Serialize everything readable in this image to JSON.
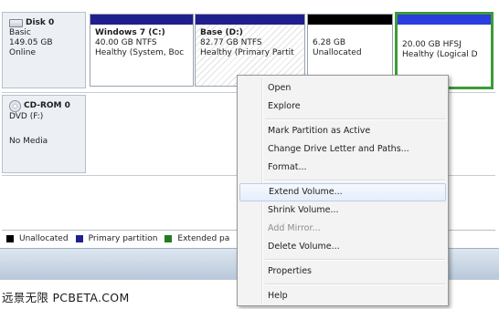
{
  "disks": [
    {
      "name": "Disk 0",
      "type": "Basic",
      "size": "149.05 GB",
      "status": "Online",
      "partitions": [
        {
          "title": "Windows 7  (C:)",
          "size_fs": "40.00 GB NTFS",
          "status": "Healthy (System, Boc",
          "bar_color": "#1f1f8e"
        },
        {
          "title": "Base  (D:)",
          "size_fs": "82.77 GB NTFS",
          "status": "Healthy (Primary Partit",
          "bar_color": "#1f1f8e"
        },
        {
          "title": "",
          "size_fs": "6.28 GB",
          "status": "Unallocated",
          "bar_color": "#000000"
        },
        {
          "title": "",
          "size_fs": "20.00 GB HFSJ",
          "status": "Healthy (Logical D",
          "bar_color": "#2b3dde"
        }
      ]
    }
  ],
  "cdrom": {
    "name": "CD-ROM 0",
    "type": "DVD (F:)",
    "status": "No Media"
  },
  "legend": [
    {
      "label": "Unallocated",
      "color": "#000000"
    },
    {
      "label": "Primary partition",
      "color": "#1f1f8e"
    },
    {
      "label": "Extended pa",
      "color": "#1f7d1f"
    }
  ],
  "context_menu": {
    "items": [
      {
        "label": "Open",
        "state": "enabled"
      },
      {
        "label": "Explore",
        "state": "enabled"
      },
      {
        "separator": true
      },
      {
        "label": "Mark Partition as Active",
        "state": "enabled"
      },
      {
        "label": "Change Drive Letter and Paths...",
        "state": "enabled"
      },
      {
        "label": "Format...",
        "state": "enabled"
      },
      {
        "separator": true
      },
      {
        "label": "Extend Volume...",
        "state": "highlighted"
      },
      {
        "label": "Shrink Volume...",
        "state": "enabled"
      },
      {
        "label": "Add Mirror...",
        "state": "disabled"
      },
      {
        "label": "Delete Volume...",
        "state": "enabled"
      },
      {
        "separator": true
      },
      {
        "label": "Properties",
        "state": "enabled"
      },
      {
        "separator": true
      },
      {
        "label": "Help",
        "state": "enabled"
      }
    ]
  },
  "watermark": "远景无限 PCBETA.COM",
  "icons": {
    "disk": "hard-disk-icon",
    "cdrom": "cd-rom-icon"
  }
}
